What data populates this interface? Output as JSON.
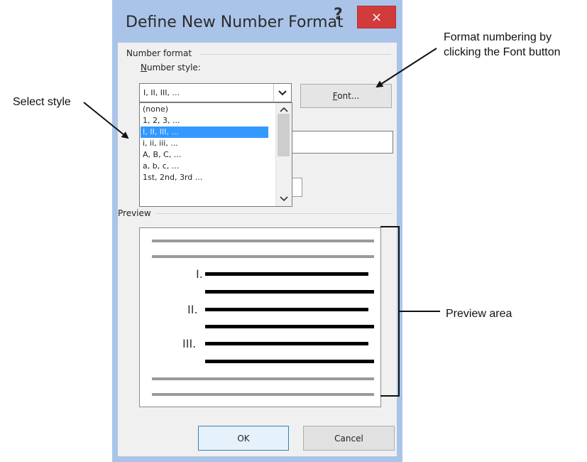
{
  "callouts": {
    "font_button": "Format numbering by\nclicking the Font button",
    "select_style": "Select style",
    "preview_area": "Preview area"
  },
  "dialog": {
    "title": "Define New Number Format",
    "help": "?",
    "close": "×",
    "group_label": "Number format",
    "number_style_label_first": "N",
    "number_style_label_rest": "umber style:",
    "combo_value": "I, II, III, ...",
    "font_button_first": "F",
    "font_button_rest": "ont...",
    "list_items": [
      "(none)",
      "1, 2, 3, ...",
      "I, II, III, ...",
      "i, ii, iii, ...",
      "A, B, C, ...",
      "a, b, c, ...",
      "1st, 2nd, 3rd ..."
    ],
    "selected_index": 2,
    "preview_label": "Preview",
    "preview_numerals": [
      "I.",
      "II.",
      "III."
    ],
    "ok": "OK",
    "cancel": "Cancel"
  }
}
